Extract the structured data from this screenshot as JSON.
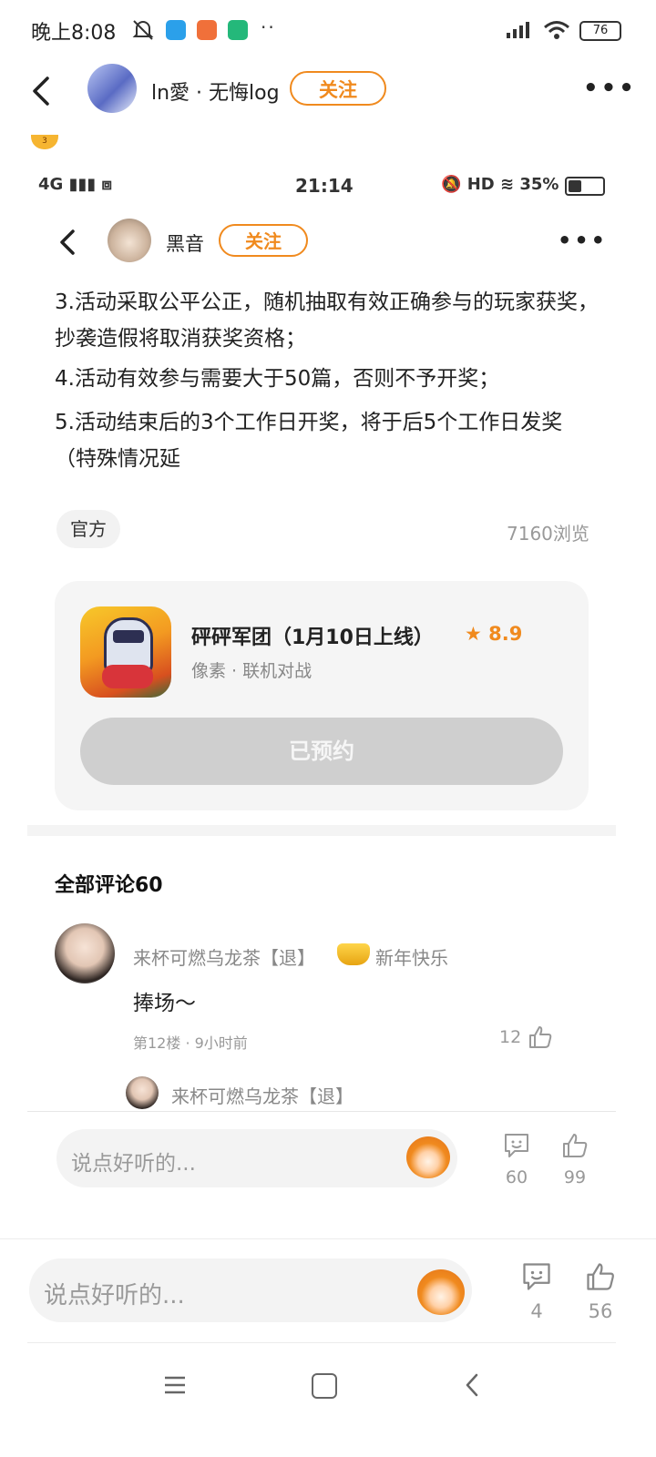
{
  "outer_status": {
    "time": "晚上8:08",
    "dots": "··",
    "battery": "76"
  },
  "outer_header": {
    "username": "ln愛 · 无悔log",
    "follow": "关注",
    "badge": "3"
  },
  "inner_status": {
    "left": "4G",
    "time": "21:14",
    "right": "HD",
    "battery": "35%"
  },
  "inner_header": {
    "username": "黑音",
    "follow": "关注"
  },
  "post": {
    "para1": "3.活动采取公平公正，随机抽取有效正确参与的玩家获奖，抄袭造假将取消获奖资格；",
    "para2": "4.活动有效参与需要大于50篇，否则不予开奖；",
    "para3": "5.活动结束后的3个工作日开奖，将于后5个工作日发奖（特殊情况延",
    "tag": "官方",
    "views": "7160浏览"
  },
  "game_card": {
    "title": "砰砰军团（1月10日上线）",
    "rating": "★ 8.9",
    "subtitle": "像素 · 联机对战",
    "button": "已预约"
  },
  "comments": {
    "header": "全部评论60",
    "items": [
      {
        "name": "来杯可燃乌龙茶【退】",
        "title": "新年快乐",
        "text": "捧场～",
        "meta": "第12楼 · 9小时前",
        "likes": "12"
      }
    ],
    "reply_name": "来杯可燃乌龙茶【退】"
  },
  "inner_input": {
    "placeholder": "说点好听的...",
    "comments": "60",
    "likes": "99"
  },
  "outer_input": {
    "placeholder": "说点好听的...",
    "comments": "4",
    "likes": "56"
  }
}
